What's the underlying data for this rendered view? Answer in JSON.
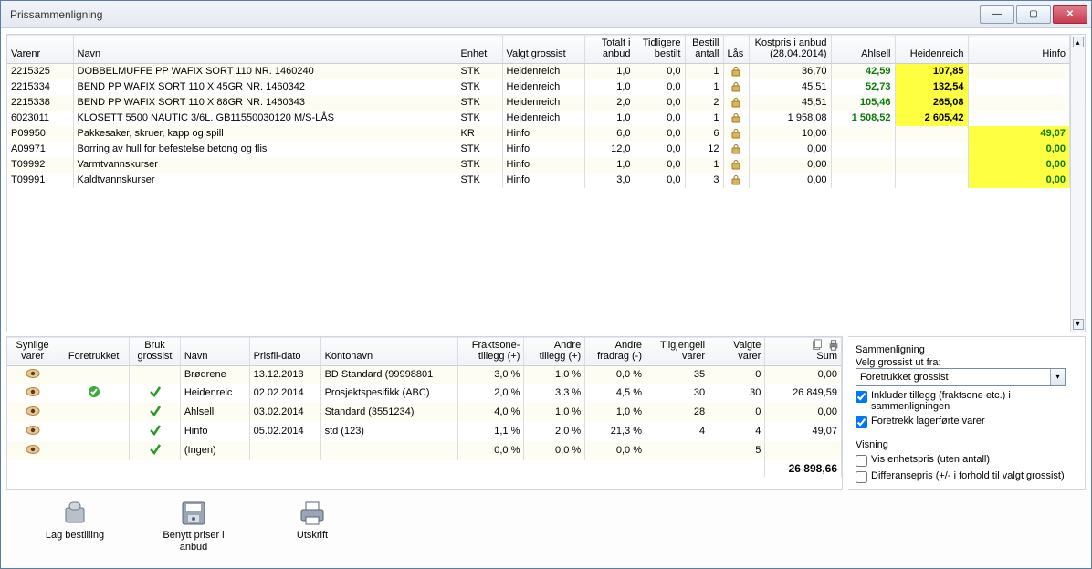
{
  "window": {
    "title": "Prissammenligning"
  },
  "topHeaders": {
    "varenr": "Varenr",
    "navn": "Navn",
    "enhet": "Enhet",
    "valgtGrossist": "Valgt grossist",
    "totalt": "Totalt i anbud",
    "tidligere": "Tidligere bestilt",
    "bestill": "Bestill antall",
    "las": "Lås",
    "kostpris": "Kostpris i anbud (28.04.2014)",
    "ahlsell": "Ahlsell",
    "heidenreich": "Heidenreich",
    "hinfo": "Hinfo"
  },
  "rows": [
    {
      "varenr": "2215325",
      "navn": "DOBBELMUFFE PP WAFIX SORT 110  NR. 1460240",
      "enhet": "STK",
      "vg": "Heidenreich",
      "tot": "1,0",
      "tidl": "0,0",
      "best": "1",
      "kost": "36,70",
      "ahl": "42,59",
      "ahlC": "hi-gl",
      "hei": "107,85",
      "heiC": "hi-y",
      "hin": ""
    },
    {
      "varenr": "2215334",
      "navn": "BEND PP WAFIX SORT 110 X 45GR  NR. 1460342",
      "enhet": "STK",
      "vg": "Heidenreich",
      "tot": "1,0",
      "tidl": "0,0",
      "best": "1",
      "kost": "45,51",
      "ahl": "52,73",
      "ahlC": "hi-gl",
      "hei": "132,54",
      "heiC": "hi-y",
      "hin": ""
    },
    {
      "varenr": "2215338",
      "navn": "BEND PP WAFIX SORT 110 X 88GR  NR. 1460343",
      "enhet": "STK",
      "vg": "Heidenreich",
      "tot": "2,0",
      "tidl": "0,0",
      "best": "2",
      "kost": "45,51",
      "ahl": "105,46",
      "ahlC": "hi-gl",
      "hei": "265,08",
      "heiC": "hi-y",
      "hin": ""
    },
    {
      "varenr": "6023011",
      "navn": "KLOSETT 5500 NAUTIC 3/6L.      GB11550030120 M/S-LÅS",
      "enhet": "STK",
      "vg": "Heidenreich",
      "tot": "1,0",
      "tidl": "0,0",
      "best": "1",
      "kost": "1 958,08",
      "ahl": "1 508,52",
      "ahlC": "hi-gl",
      "hei": "2 605,42",
      "heiC": "hi-y",
      "hin": ""
    },
    {
      "varenr": "P09950",
      "navn": "Pakkesaker, skruer, kapp og spill",
      "enhet": "KR",
      "vg": "Hinfo",
      "tot": "6,0",
      "tidl": "0,0",
      "best": "6",
      "kost": "10,00",
      "ahl": "",
      "ahlC": "",
      "hei": "",
      "heiC": "",
      "hin": "49,07",
      "hinC": "hi-g"
    },
    {
      "varenr": "A09971",
      "navn": "Borring av hull for befestelse betong og flis",
      "enhet": "STK",
      "vg": "Hinfo",
      "tot": "12,0",
      "tidl": "0,0",
      "best": "12",
      "kost": "0,00",
      "ahl": "",
      "ahlC": "",
      "hei": "",
      "heiC": "",
      "hin": "0,00",
      "hinC": "hi-g"
    },
    {
      "varenr": "T09992",
      "navn": "Varmtvannskurser",
      "enhet": "STK",
      "vg": "Hinfo",
      "tot": "1,0",
      "tidl": "0,0",
      "best": "1",
      "kost": "0,00",
      "ahl": "",
      "ahlC": "",
      "hei": "",
      "heiC": "",
      "hin": "0,00",
      "hinC": "hi-g"
    },
    {
      "varenr": "T09991",
      "navn": "Kaldtvannskurser",
      "enhet": "STK",
      "vg": "Hinfo",
      "tot": "3,0",
      "tidl": "0,0",
      "best": "3",
      "kost": "0,00",
      "ahl": "",
      "ahlC": "",
      "hei": "",
      "heiC": "",
      "hin": "0,00",
      "hinC": "hi-g"
    }
  ],
  "botHeaders": {
    "synlige": "Synlige varer",
    "foretrukket": "Foretrukket",
    "bruk": "Bruk grossist",
    "navn": "Navn",
    "prisdato": "Prisfil-dato",
    "konto": "Kontonavn",
    "frakt": "Fraktsone-tillegg (+)",
    "andreT": "Andre tillegg (+)",
    "andreF": "Andre fradrag (-)",
    "tilgj": "Tilgjengeli varer",
    "valgte": "Valgte varer",
    "sum": "Sum"
  },
  "grossers": [
    {
      "eye": true,
      "pref": false,
      "bruk": false,
      "navn": "Brødrene",
      "dato": "13.12.2013",
      "konto": "BD Standard (99998801",
      "frakt": "3,0 %",
      "at": "1,0 %",
      "af": "0,0 %",
      "tilgj": "35",
      "valgte": "0",
      "sum": "0,00"
    },
    {
      "eye": true,
      "pref": true,
      "bruk": true,
      "navn": "Heidenreic",
      "dato": "02.02.2014",
      "konto": "Prosjektspesifikk (ABC)",
      "frakt": "2,0 %",
      "at": "3,3 %",
      "af": "4,5 %",
      "tilgj": "30",
      "valgte": "30",
      "sum": "26 849,59"
    },
    {
      "eye": true,
      "pref": false,
      "bruk": true,
      "navn": "Ahlsell",
      "dato": "03.02.2014",
      "konto": "Standard (3551234)",
      "frakt": "4,0 %",
      "at": "1,0 %",
      "af": "1,0 %",
      "tilgj": "28",
      "valgte": "0",
      "sum": "0,00"
    },
    {
      "eye": true,
      "pref": false,
      "bruk": true,
      "navn": "Hinfo",
      "dato": "05.02.2014",
      "konto": "std (123)",
      "frakt": "1,1 %",
      "at": "2,0 %",
      "af": "21,3 %",
      "tilgj": "4",
      "valgte": "4",
      "sum": "49,07"
    },
    {
      "eye": true,
      "pref": false,
      "bruk": true,
      "navn": "(Ingen)",
      "dato": "",
      "konto": "",
      "frakt": "0,0 %",
      "at": "0,0 %",
      "af": "0,0 %",
      "tilgj": "",
      "valgte": "5",
      "sum": ""
    }
  ],
  "sumTotal": "26 898,66",
  "side": {
    "sammenligning": "Sammenligning",
    "velgGrossist": "Velg grossist ut fra:",
    "ddValue": "Foretrukket grossist",
    "inkluder": "Inkluder tillegg (fraktsone etc.) i sammenligningen",
    "foretrekk": "Foretrekk lagerførte varer",
    "visning": "Visning",
    "visEnhet": "Vis enhetspris (uten antall)",
    "diff": "Differansepris (+/- i forhold til valgt grossist)"
  },
  "tools": {
    "lag": "Lag bestilling",
    "benytt": "Benytt priser i anbud",
    "utskrift": "Utskrift"
  }
}
